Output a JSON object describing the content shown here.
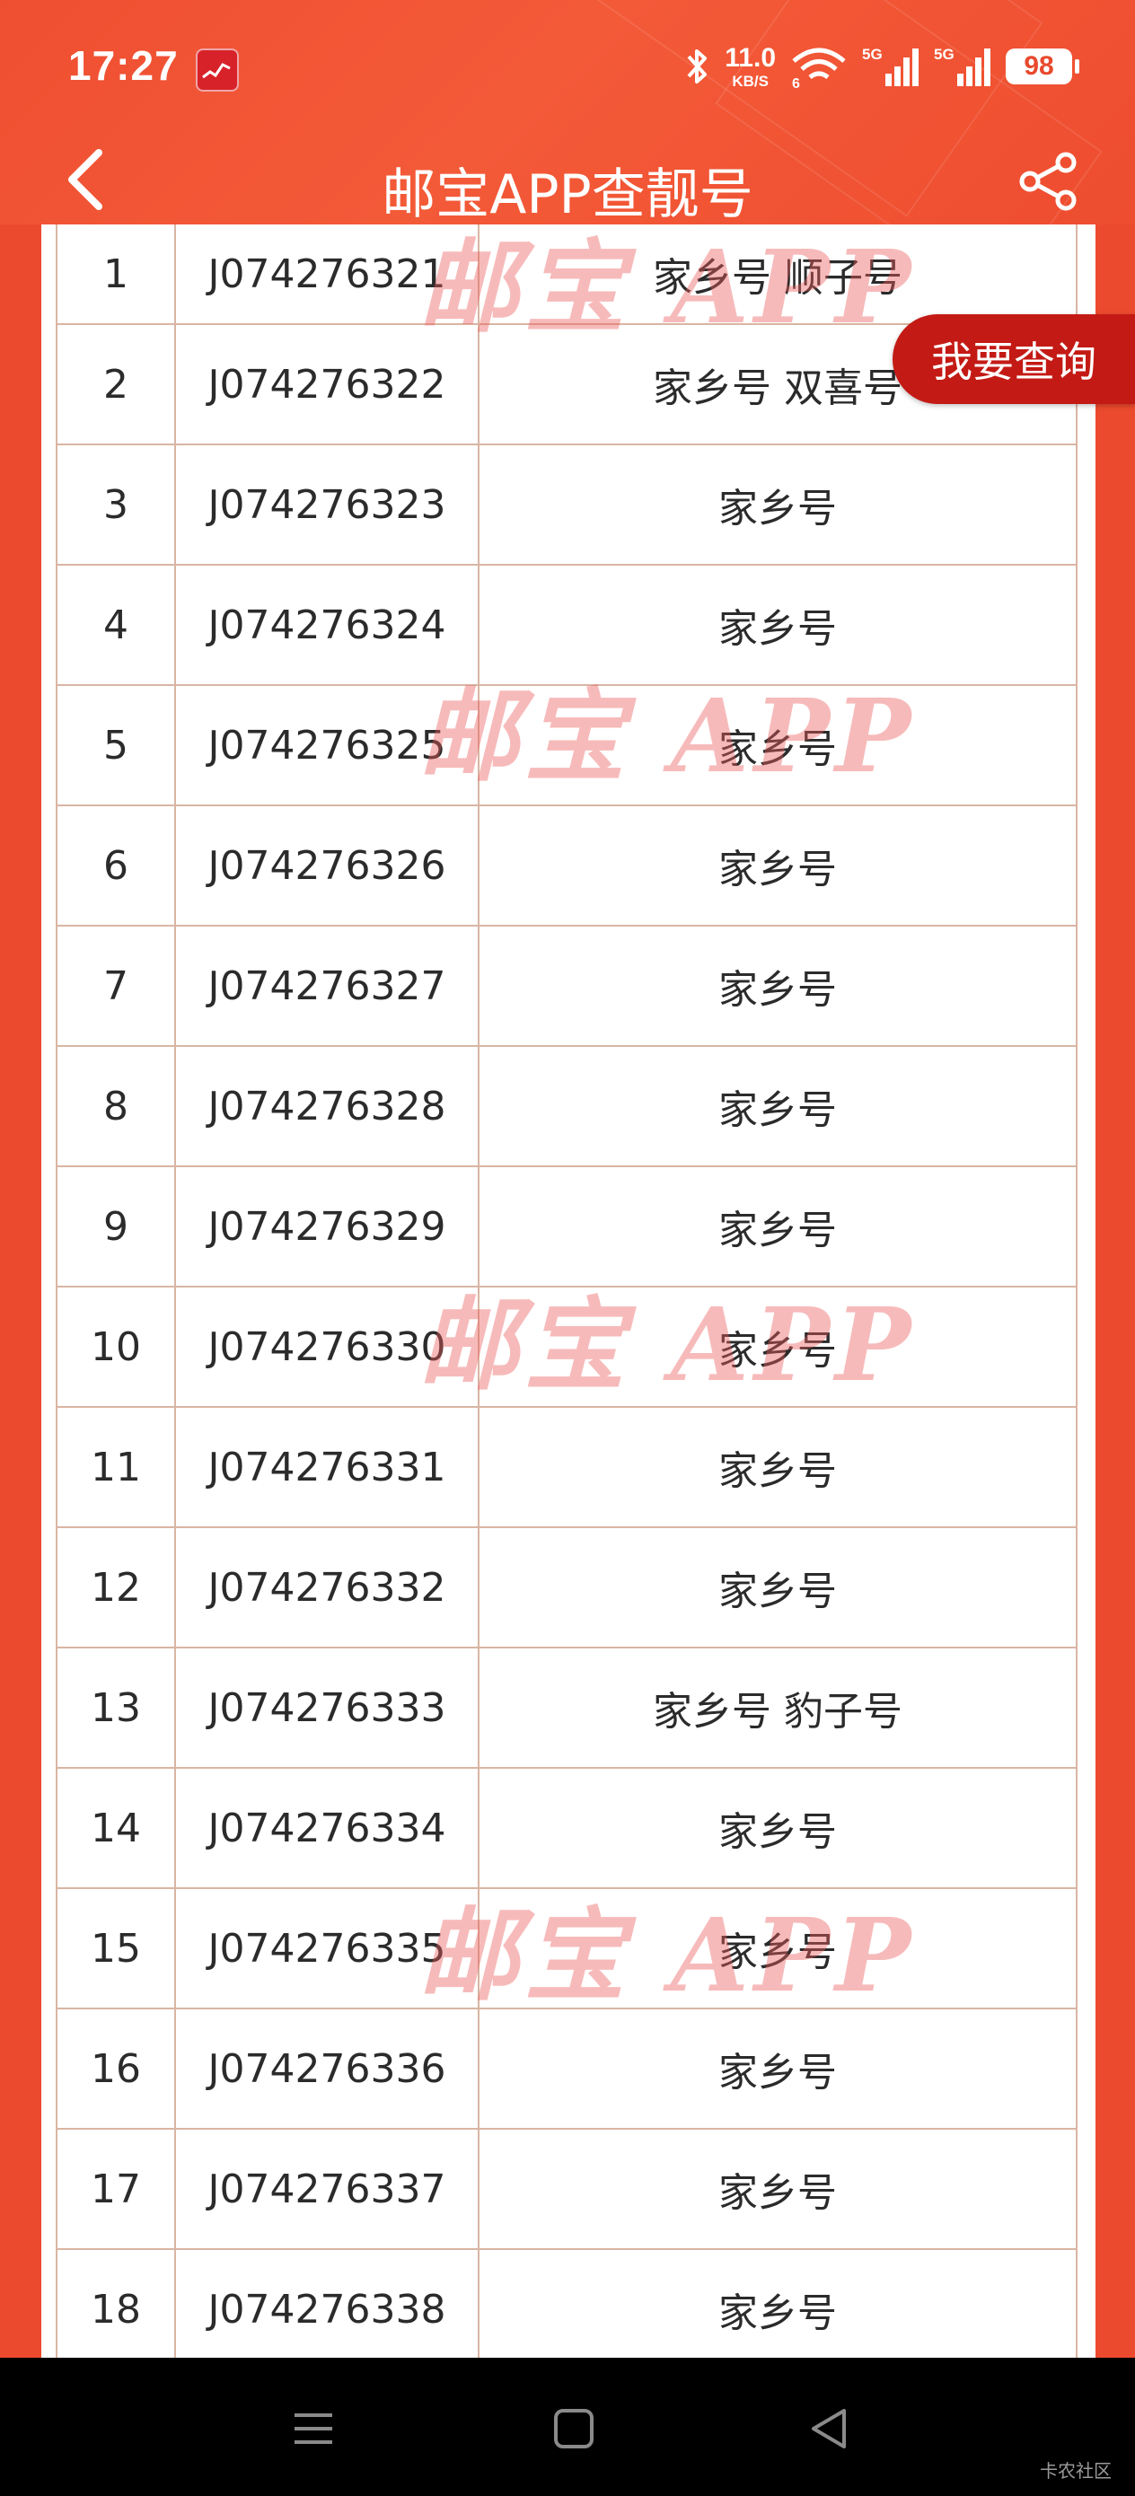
{
  "status_bar": {
    "time": "17:27",
    "net_speed_value": "11.0",
    "net_speed_unit": "KB/S",
    "wifi_sub": "6",
    "signal1_label": "5G",
    "signal2_label": "5G",
    "battery": "98"
  },
  "app_bar": {
    "title": "邮宝APP查靓号",
    "back_icon": "chevron-left-icon",
    "share_icon": "share-icon"
  },
  "query_button": "我要查询",
  "watermark": "邮宝 APP",
  "rows": [
    {
      "no": "1",
      "code": "J074276321",
      "tag": "家乡号 顺子号"
    },
    {
      "no": "2",
      "code": "J074276322",
      "tag": "家乡号 双喜号"
    },
    {
      "no": "3",
      "code": "J074276323",
      "tag": "家乡号"
    },
    {
      "no": "4",
      "code": "J074276324",
      "tag": "家乡号"
    },
    {
      "no": "5",
      "code": "J074276325",
      "tag": "家乡号"
    },
    {
      "no": "6",
      "code": "J074276326",
      "tag": "家乡号"
    },
    {
      "no": "7",
      "code": "J074276327",
      "tag": "家乡号"
    },
    {
      "no": "8",
      "code": "J074276328",
      "tag": "家乡号"
    },
    {
      "no": "9",
      "code": "J074276329",
      "tag": "家乡号"
    },
    {
      "no": "10",
      "code": "J074276330",
      "tag": "家乡号"
    },
    {
      "no": "11",
      "code": "J074276331",
      "tag": "家乡号"
    },
    {
      "no": "12",
      "code": "J074276332",
      "tag": "家乡号"
    },
    {
      "no": "13",
      "code": "J074276333",
      "tag": "家乡号 豹子号"
    },
    {
      "no": "14",
      "code": "J074276334",
      "tag": "家乡号"
    },
    {
      "no": "15",
      "code": "J074276335",
      "tag": "家乡号"
    },
    {
      "no": "16",
      "code": "J074276336",
      "tag": "家乡号"
    },
    {
      "no": "17",
      "code": "J074276337",
      "tag": "家乡号"
    },
    {
      "no": "18",
      "code": "J074276338",
      "tag": "家乡号"
    }
  ],
  "nav_bar": {
    "menu_icon": "menu-icon",
    "home_icon": "home-square-icon",
    "back_icon": "back-triangle-icon",
    "corner_label": "卡农社区"
  }
}
